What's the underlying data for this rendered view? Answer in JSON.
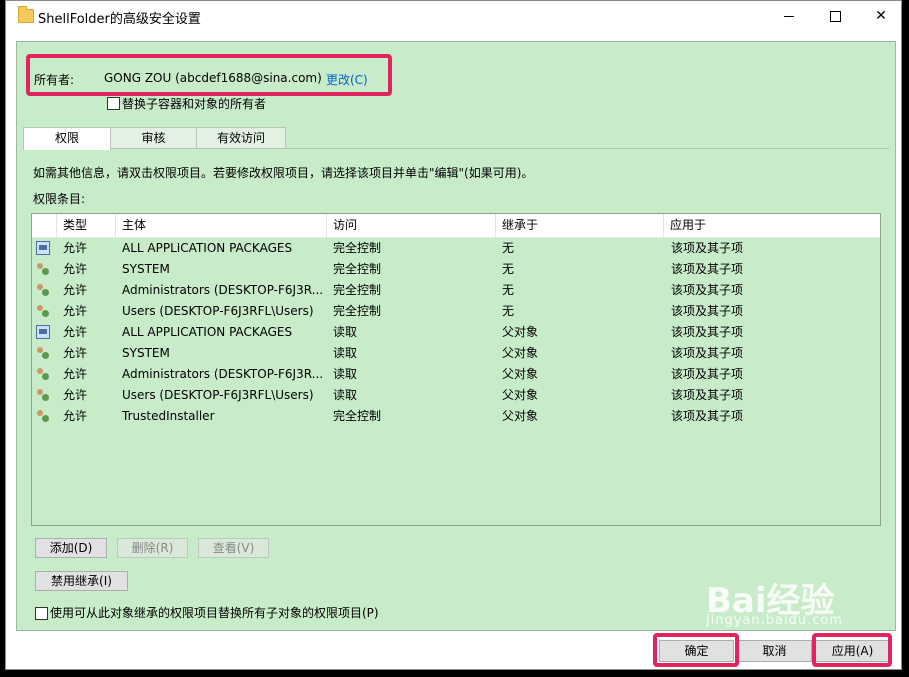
{
  "window": {
    "title": "ShellFolder的高级安全设置"
  },
  "owner": {
    "label": "所有者:",
    "value": "GONG ZOU (abcdef1688@sina.com)",
    "change_link": "更改(C)",
    "replace_checkbox_label": "替换子容器和对象的所有者",
    "replace_checked": false
  },
  "tabs": [
    {
      "label": "权限",
      "active": true
    },
    {
      "label": "审核",
      "active": false
    },
    {
      "label": "有效访问",
      "active": false
    }
  ],
  "info_text": "如需其他信息，请双击权限项目。若要修改权限项目，请选择该项目并单击\"编辑\"(如果可用)。",
  "perm_list_title": "权限条目:",
  "table": {
    "headers": [
      "类型",
      "主体",
      "访问",
      "继承于",
      "应用于"
    ],
    "rows": [
      {
        "icon": "package-icon",
        "type": "允许",
        "principal": "ALL APPLICATION PACKAGES",
        "access": "完全控制",
        "inherited": "无",
        "applies": "该项及其子项"
      },
      {
        "icon": "user-group-icon",
        "type": "允许",
        "principal": "SYSTEM",
        "access": "完全控制",
        "inherited": "无",
        "applies": "该项及其子项"
      },
      {
        "icon": "user-group-icon",
        "type": "允许",
        "principal": "Administrators (DESKTOP-F6J3R...",
        "access": "完全控制",
        "inherited": "无",
        "applies": "该项及其子项"
      },
      {
        "icon": "user-group-icon",
        "type": "允许",
        "principal": "Users (DESKTOP-F6J3RFL\\Users)",
        "access": "完全控制",
        "inherited": "无",
        "applies": "该项及其子项"
      },
      {
        "icon": "package-icon",
        "type": "允许",
        "principal": "ALL APPLICATION PACKAGES",
        "access": "读取",
        "inherited": "父对象",
        "applies": "该项及其子项"
      },
      {
        "icon": "user-group-icon",
        "type": "允许",
        "principal": "SYSTEM",
        "access": "读取",
        "inherited": "父对象",
        "applies": "该项及其子项"
      },
      {
        "icon": "user-group-icon",
        "type": "允许",
        "principal": "Administrators (DESKTOP-F6J3R...",
        "access": "读取",
        "inherited": "父对象",
        "applies": "该项及其子项"
      },
      {
        "icon": "user-group-icon",
        "type": "允许",
        "principal": "Users (DESKTOP-F6J3RFL\\Users)",
        "access": "读取",
        "inherited": "父对象",
        "applies": "该项及其子项"
      },
      {
        "icon": "user-group-icon",
        "type": "允许",
        "principal": "TrustedInstaller",
        "access": "完全控制",
        "inherited": "父对象",
        "applies": "该项及其子项"
      }
    ]
  },
  "buttons": {
    "add": "添加(D)",
    "remove": "删除(R)",
    "view": "查看(V)",
    "disable_inheritance": "禁用继承(I)"
  },
  "inherit_checkbox_label": "使用可从此对象继承的权限项目替换所有子对象的权限项目(P)",
  "inherit_checked": false,
  "footer": {
    "ok": "确定",
    "cancel": "取消",
    "apply": "应用(A)"
  },
  "watermark": {
    "main": "Bai经验",
    "sub": "jingyan.baidu.com"
  },
  "colors": {
    "panel_bg": "#c8ecc9",
    "highlight": "#e0245e",
    "link": "#0066cc"
  }
}
